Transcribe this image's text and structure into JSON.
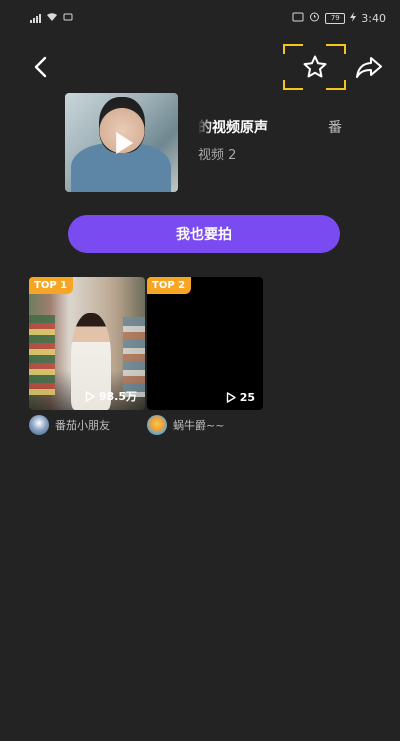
{
  "status_bar": {
    "carrier": "⁴⁶ıl",
    "battery": "79",
    "time": "3:40"
  },
  "nav": {
    "back_icon": "chevron-left-icon",
    "favorite_icon": "star-outline-icon",
    "share_icon": "share-arrow-icon",
    "highlight_color": "#f5c518"
  },
  "music": {
    "title": "的视频原声",
    "title_extra": "番",
    "count_label": "视频",
    "count_value": "2"
  },
  "shoot_button": {
    "label": "我也要拍",
    "color": "#7a4bf0"
  },
  "videos": [
    {
      "badge": "TOP 1",
      "views": "98.5万",
      "author": "番茄小朋友"
    },
    {
      "badge": "TOP 2",
      "views": "25",
      "author": "蜗牛爵~~"
    }
  ],
  "colors": {
    "background": "#232323",
    "badge": "#f6a623"
  }
}
